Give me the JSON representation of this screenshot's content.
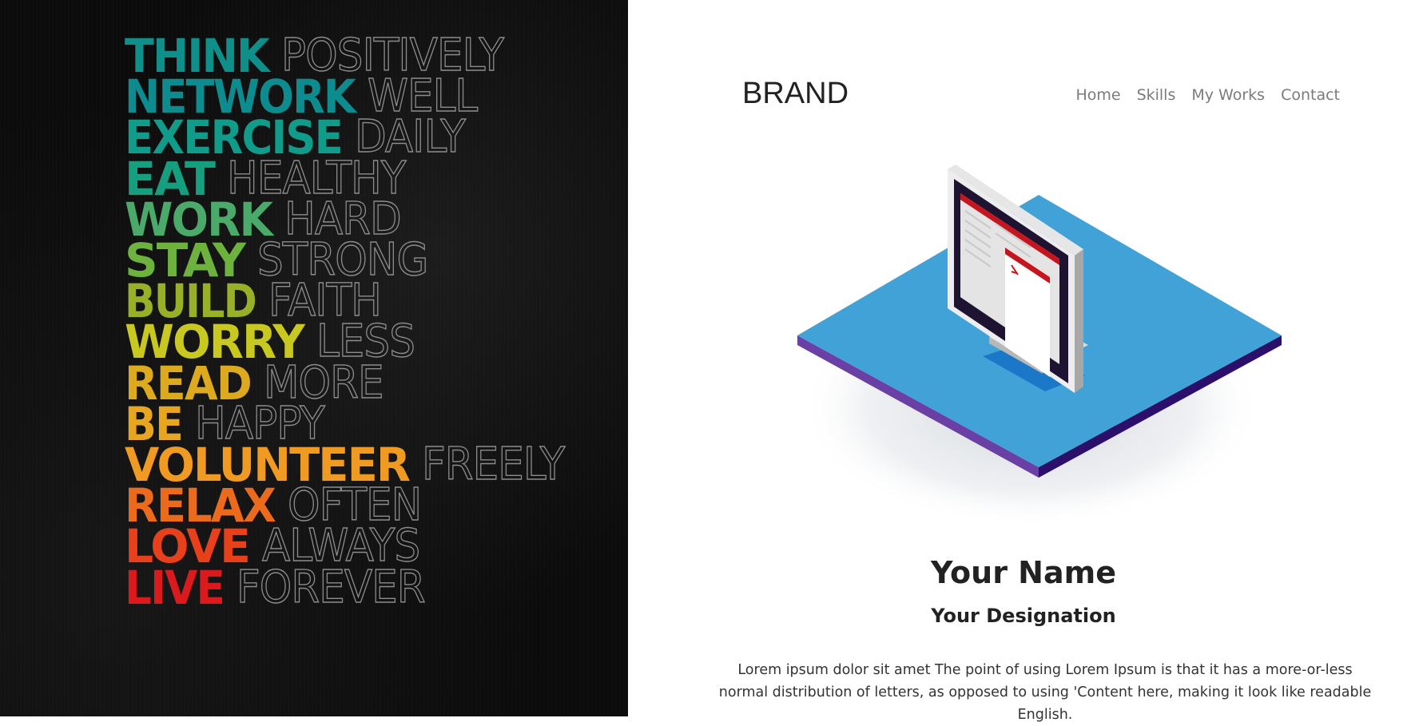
{
  "poster": {
    "lines": [
      {
        "bold": "THINK",
        "thin": "POSITIVELY",
        "color": "#0f8f8a"
      },
      {
        "bold": "NETWORK",
        "thin": "WELL",
        "color": "#0d8c90"
      },
      {
        "bold": "EXERCISE",
        "thin": "DAILY",
        "color": "#0f9c8a"
      },
      {
        "bold": "EAT",
        "thin": "HEALTHY",
        "color": "#14a07e"
      },
      {
        "bold": "WORK",
        "thin": "HARD",
        "color": "#4aaa6a"
      },
      {
        "bold": "STAY",
        "thin": "STRONG",
        "color": "#6cb23c"
      },
      {
        "bold": "BUILD",
        "thin": "FAITH",
        "color": "#97b026"
      },
      {
        "bold": "WORRY",
        "thin": "LESS",
        "color": "#c8c81e"
      },
      {
        "bold": "READ",
        "thin": "MORE",
        "color": "#dcaa1c"
      },
      {
        "bold": "BE",
        "thin": "HAPPY",
        "color": "#e8a61e"
      },
      {
        "bold": "VOLUNTEER",
        "thin": "FREELY",
        "color": "#f09a22"
      },
      {
        "bold": "RELAX",
        "thin": "OFTEN",
        "color": "#ec6a1c"
      },
      {
        "bold": "LOVE",
        "thin": "ALWAYS",
        "color": "#e8401a"
      },
      {
        "bold": "LIVE",
        "thin": "FOREVER",
        "color": "#dc1a1e"
      }
    ]
  },
  "header": {
    "brand": "BRAND",
    "nav": [
      {
        "label": "Home"
      },
      {
        "label": "Skills"
      },
      {
        "label": "My Works"
      },
      {
        "label": "Contact"
      }
    ]
  },
  "profile": {
    "name": "Your Name",
    "designation": "Your Designation",
    "bio": "Lorem ipsum dolor sit amet The point of using Lorem Ipsum is that it has a more-or-less normal distribution of letters, as opposed to using 'Content here, making it look like readable English."
  },
  "colors": {
    "platform_top": "#41a2d8",
    "platform_left_edge": "#6a3fa6",
    "platform_right_edge": "#2b0f6b",
    "screen_accent": "#c8141c",
    "monitor_shadow": "#1b78c8"
  }
}
